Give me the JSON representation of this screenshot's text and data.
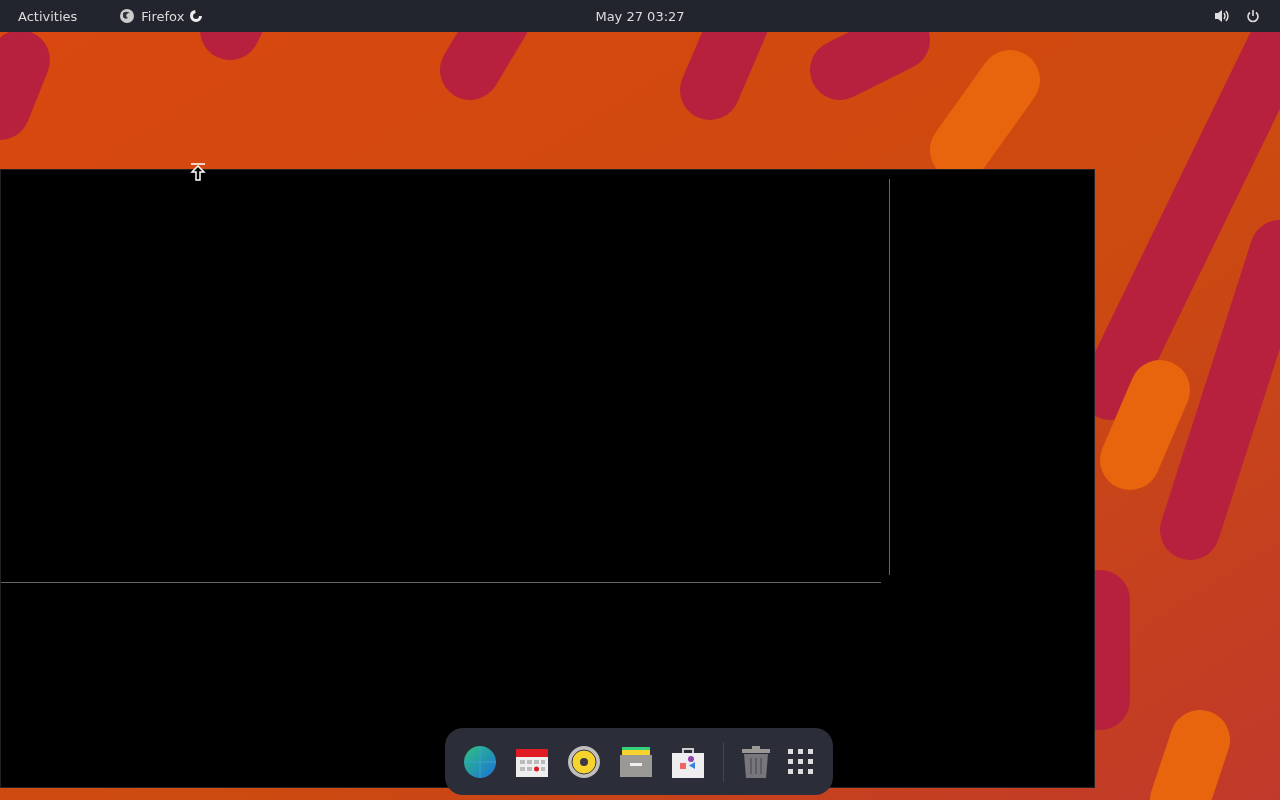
{
  "top_bar": {
    "activities": "Activities",
    "app_name": "Firefox",
    "clock": "May 27  03:27"
  }
}
